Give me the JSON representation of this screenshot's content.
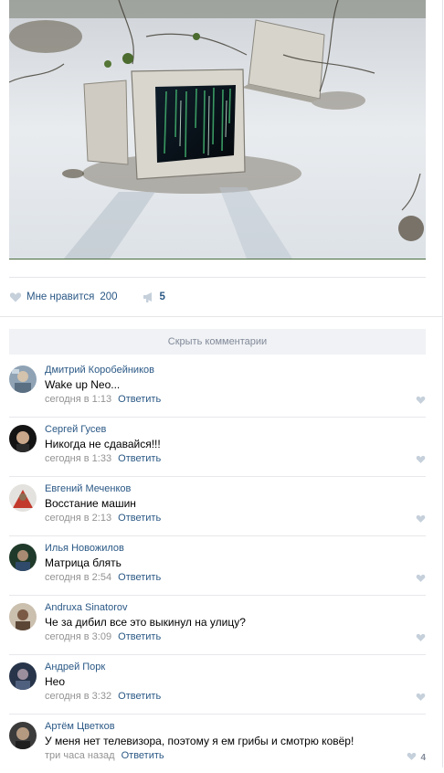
{
  "post": {
    "likes": {
      "label": "Мне нравится",
      "count": "200"
    },
    "shares": {
      "count": "5"
    },
    "hide_comments_label": "Скрыть комментарии"
  },
  "comments": [
    {
      "author": "Дмитрий Коробейников",
      "text": "Wake up Neo...",
      "time": "сегодня в 1:13",
      "reply": "Ответить",
      "likes": ""
    },
    {
      "author": "Сергей Гусев",
      "text": "Никогда не сдавайся!!!",
      "time": "сегодня в 1:33",
      "reply": "Ответить",
      "likes": ""
    },
    {
      "author": "Евгений Меченков",
      "text": "Восстание машин",
      "time": "сегодня в 2:13",
      "reply": "Ответить",
      "likes": ""
    },
    {
      "author": "Илья Новожилов",
      "text": "Матрица блять",
      "time": "сегодня в 2:54",
      "reply": "Ответить",
      "likes": ""
    },
    {
      "author": "Andruxa Sinatorov",
      "text": "Че за дибил все это выкинул на улицу?",
      "time": "сегодня в 3:09",
      "reply": "Ответить",
      "likes": ""
    },
    {
      "author": "Андрей Порк",
      "text": "Нео",
      "time": "сегодня в 3:32",
      "reply": "Ответить",
      "likes": ""
    },
    {
      "author": "Артём Цветков",
      "text": "У меня нет телевизора, поэтому я ем грибы и смотрю ковёр!",
      "time": "три часа назад",
      "reply": "Ответить",
      "likes": "4"
    }
  ],
  "icons": {
    "like": "heart-icon",
    "share": "megaphone-icon",
    "comment_like": "heart-icon"
  },
  "colors": {
    "link": "#2a5885",
    "meta": "#939393",
    "hide_bg": "#f0f2f5",
    "icon_gray": "#c5d0db"
  }
}
